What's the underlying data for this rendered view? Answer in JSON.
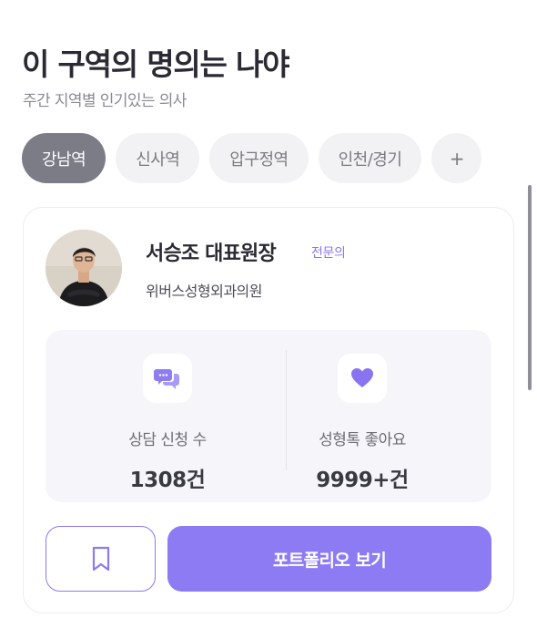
{
  "header": {
    "title": "이 구역의 명의는 나야",
    "subtitle": "주간 지역별 인기있는 의사"
  },
  "tabs": [
    {
      "label": "강남역",
      "active": true
    },
    {
      "label": "신사역",
      "active": false
    },
    {
      "label": "압구정역",
      "active": false
    },
    {
      "label": "인천/경기",
      "active": false
    },
    {
      "label": "+",
      "active": false
    }
  ],
  "doctor": {
    "name": "서승조 대표원장",
    "badge": "전문의",
    "clinic": "위버스성형외과의원",
    "avatar_icon": "doctor-portrait"
  },
  "stats": {
    "consult": {
      "icon": "chat-bubbles-icon",
      "label": "상담 신청 수",
      "value": "1308건"
    },
    "likes": {
      "icon": "heart-icon",
      "label": "성형톡 좋아요",
      "value": "9999+건"
    }
  },
  "actions": {
    "bookmark_icon": "bookmark-icon",
    "portfolio_label": "포트폴리오 보기"
  },
  "colors": {
    "accent": "#8d7bf4",
    "active_tab": "#7c7c87",
    "badge": "#8b76f2"
  }
}
